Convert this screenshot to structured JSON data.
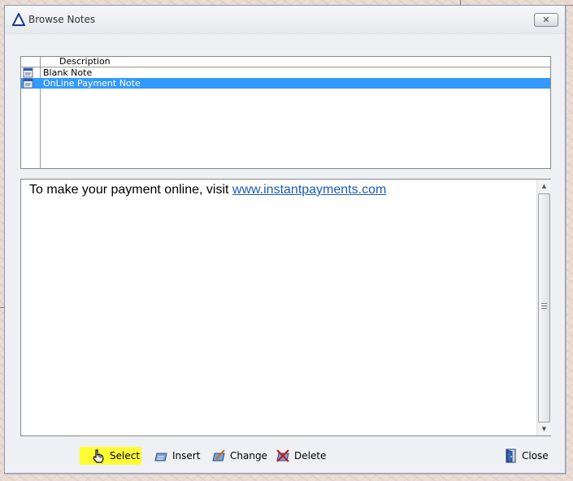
{
  "window": {
    "title": "Browse Notes",
    "close_glyph": "✕"
  },
  "grid": {
    "columns": [
      "Description"
    ],
    "rows": [
      {
        "label": "Blank Note",
        "selected": false
      },
      {
        "label": "OnLine Payment Note",
        "selected": true
      }
    ]
  },
  "note": {
    "text": "To make your payment online, visit ",
    "link": "www.instantpayments.com"
  },
  "toolbar": {
    "select_label": "Select",
    "insert_label": "Insert",
    "change_label": "Change",
    "delete_label": "Delete",
    "close_label": "Close"
  },
  "colors": {
    "selection": "#3399ff",
    "highlight": "#ffff33",
    "link": "#1a5cb3"
  },
  "icons": [
    "app-triangle-icon",
    "note-row-icon",
    "hand-pointer-icon",
    "insert-icon",
    "change-icon",
    "delete-icon",
    "door-exit-icon",
    "scroll-up-icon",
    "scroll-down-icon"
  ]
}
